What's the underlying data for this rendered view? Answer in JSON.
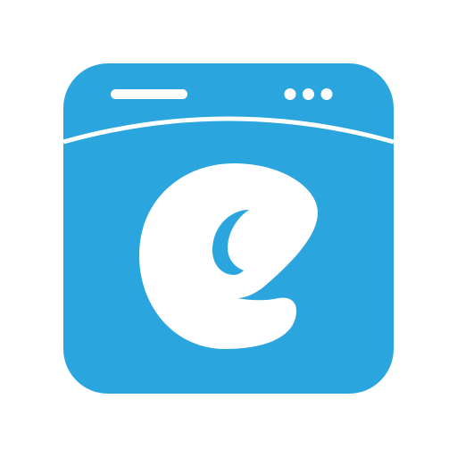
{
  "icon": {
    "name": "browser-window-logo-icon",
    "colors": {
      "background": "#ffffff",
      "tile": "#2ba5de",
      "foreground": "#ffffff"
    },
    "header": {
      "title_bar": "title-bar-line",
      "menu": "three-dots-icon"
    },
    "glyph": "e-letter-logo"
  }
}
